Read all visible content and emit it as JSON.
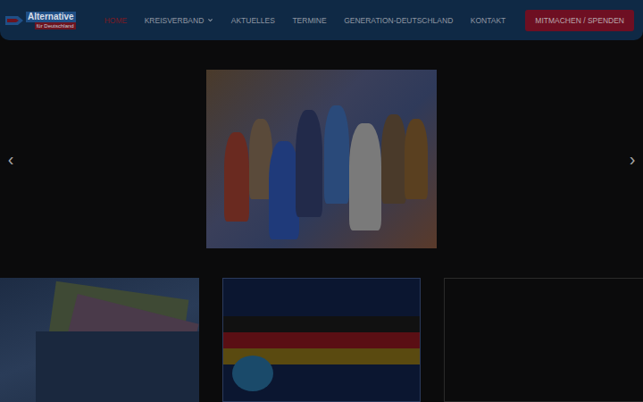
{
  "logo": {
    "main": "Alternative",
    "sub": "für Deutschland"
  },
  "nav": [
    {
      "label": "HOME",
      "selected": true,
      "dropdown": false
    },
    {
      "label": "KREISVERBAND",
      "selected": false,
      "dropdown": true
    },
    {
      "label": "AKTUELLES",
      "selected": false,
      "dropdown": false
    },
    {
      "label": "TERMINE",
      "selected": false,
      "dropdown": false
    },
    {
      "label": "GENERATION-DEUTSCHLAND",
      "selected": false,
      "dropdown": false
    },
    {
      "label": "KONTAKT",
      "selected": false,
      "dropdown": false
    }
  ],
  "cta": "MITMACHEN / SPENDEN",
  "slider": {
    "prev": "‹",
    "next": "›"
  },
  "cards": [
    {
      "kind": "money"
    },
    {
      "kind": "poster"
    },
    {
      "kind": "empty"
    }
  ]
}
